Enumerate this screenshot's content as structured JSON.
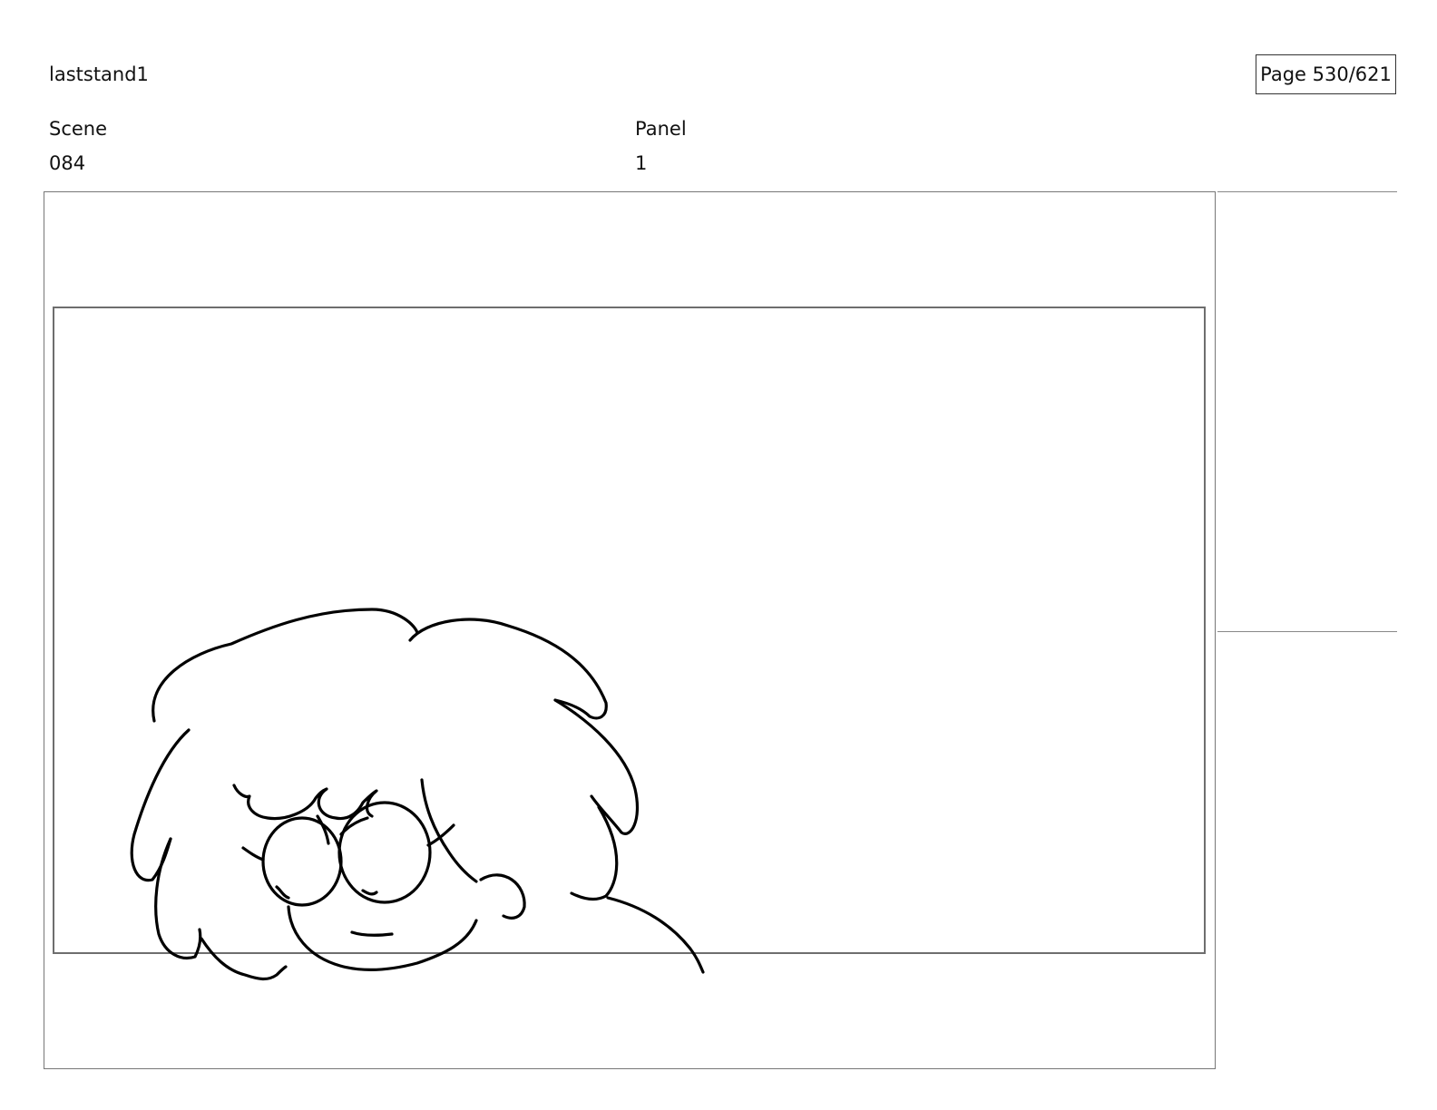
{
  "header": {
    "project_title": "laststand1",
    "page_indicator": "Page 530/621"
  },
  "fields": {
    "scene_label": "Scene",
    "scene_value": "084",
    "panel_label": "Panel",
    "panel_value": "1"
  }
}
